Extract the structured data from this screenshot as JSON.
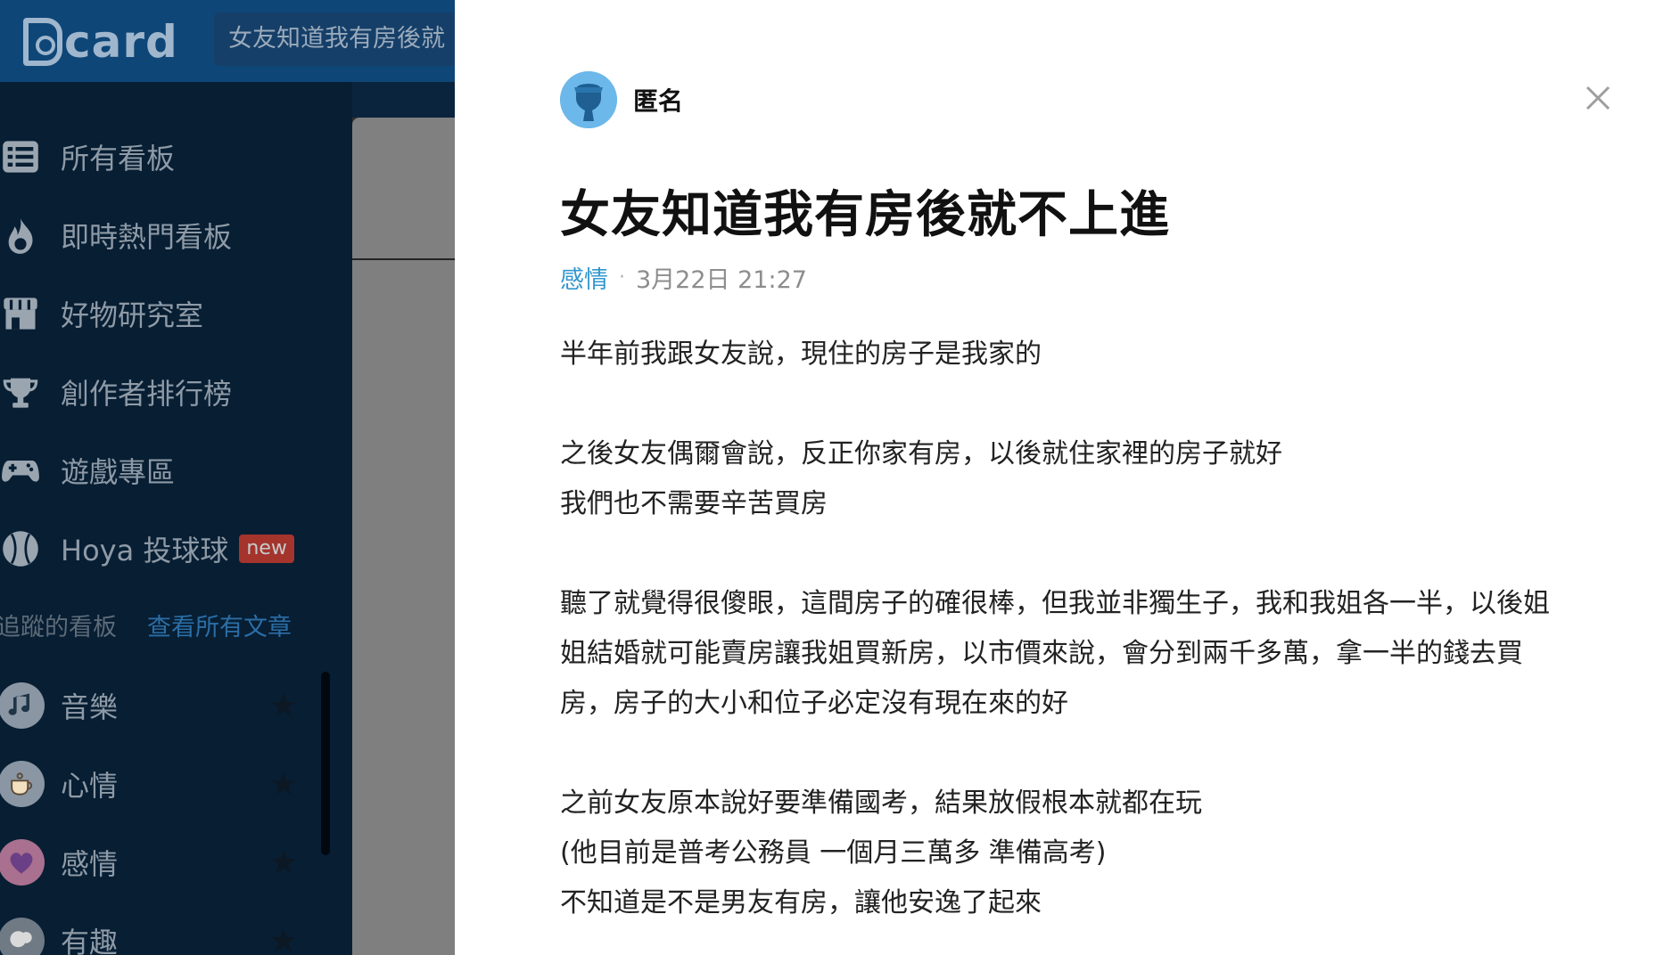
{
  "app": {
    "logo_text": "card",
    "search_value": "女友知道我有房後就"
  },
  "sidebar": {
    "items": [
      {
        "label": "所有看板",
        "icon": "list-icon"
      },
      {
        "label": "即時熱門看板",
        "icon": "fire-icon"
      },
      {
        "label": "好物研究室",
        "icon": "store-icon"
      },
      {
        "label": "創作者排行榜",
        "icon": "trophy-icon"
      },
      {
        "label": "遊戲專區",
        "icon": "gamepad-icon"
      },
      {
        "label": "Hoya 投球球",
        "icon": "baseball-icon",
        "badge": "new"
      }
    ],
    "following_label": "追蹤的看板",
    "view_all_label": "查看所有文章",
    "boards": [
      {
        "label": "音樂",
        "icon": "music-icon"
      },
      {
        "label": "心情",
        "icon": "coffee-icon"
      },
      {
        "label": "感情",
        "icon": "heart-icon"
      },
      {
        "label": "有趣",
        "icon": "alpaca-icon"
      }
    ]
  },
  "post": {
    "author": "匿名",
    "title": "女友知道我有房後就不上進",
    "board": "感情",
    "separator": "·",
    "time": "3月22日 21:27",
    "lines": [
      "半年前我跟女友說，現住的房子是我家的",
      "",
      "之後女友偶爾會說，反正你家有房，以後就住家裡的房子就好",
      "我們也不需要辛苦買房",
      "",
      "聽了就覺得很傻眼，這間房子的確很棒，但我並非獨生子，我和我姐各一半，以後姐",
      "姐結婚就可能賣房讓我姐買新房，以市價來說，會分到兩千多萬，拿一半的錢去買",
      "房，房子的大小和位子必定沒有現在來的好",
      "",
      "之前女友原本說好要準備國考，結果放假根本就都在玩",
      "(他目前是普考公務員 一個月三萬多 準備高考)",
      "不知道是不是男友有房，讓他安逸了起來"
    ]
  },
  "colors": {
    "header_bg": "#0e4678",
    "sidebar_bg": "#071e33",
    "accent_link": "#3397cf",
    "avatar_bg": "#65b3e6",
    "badge_bg": "#c0392b"
  }
}
